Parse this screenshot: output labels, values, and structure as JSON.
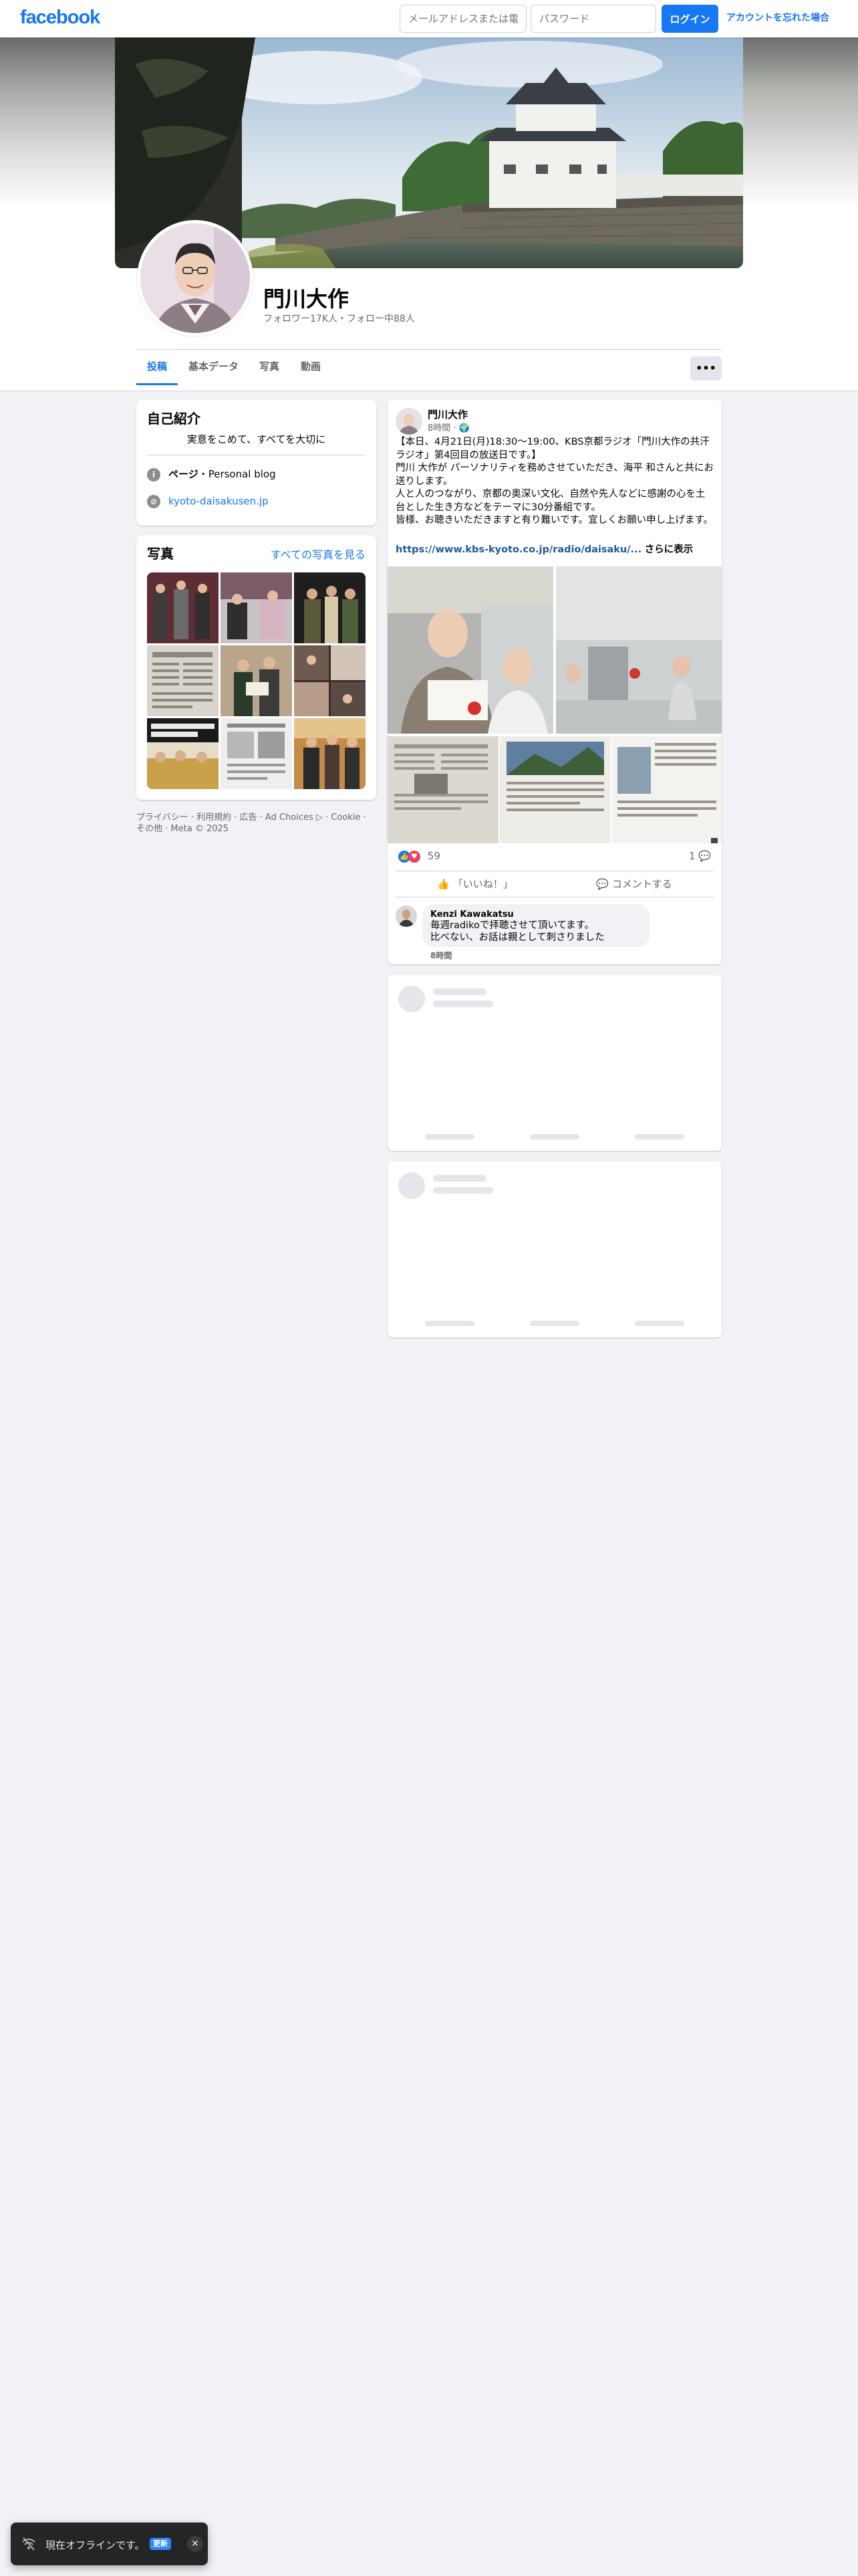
{
  "topbar": {
    "logo": "facebook",
    "email_placeholder": "メールアドレスまたは電話番号",
    "password_placeholder": "パスワード",
    "login_label": "ログイン",
    "forgot_label": "アカウントを忘れた場合"
  },
  "profile": {
    "name": "門川大作",
    "stats": "フォロワー17K人・フォロー中88人"
  },
  "tabs": [
    {
      "label": "投稿"
    },
    {
      "label": "基本データ"
    },
    {
      "label": "写真"
    },
    {
      "label": "動画"
    }
  ],
  "more_label": "•••",
  "intro": {
    "title": "自己紹介",
    "bio": "実意をこめて、すべてを大切に",
    "page_bold": "ページ",
    "page_text": "・Personal blog",
    "website": "kyoto-daisakusen.jp"
  },
  "photos": {
    "title": "写真",
    "see_all": "すべての写真を見る"
  },
  "footer": {
    "line1": "プライバシー · 利用規約 · 広告 · Ad Choices ▷ · Cookie ·",
    "line2": "その他 · Meta © 2025"
  },
  "post": {
    "author": "門川大作",
    "time": "8時間 · 🌍",
    "lines": [
      "【本日、4月21日(月)18:30〜19:00、KBS京都ラジオ「門川大作の共汗ラジオ」第4回目の放送日です。】",
      "門川 大作が パーソナリティを務めさせていただき、海平 和さんと共にお送りします。",
      "人と人のつながり、京都の奥深い文化、自然や先人などに感謝の心を土台とした生き方などをテーマに30分番組です。",
      "皆様、お聴きいただきますと有り難いです。宜しくお願い申し上げます。"
    ],
    "url": "https://www.kbs-kyoto.co.jp/radio/daisaku/...",
    "see_more": "さらに表示",
    "reaction_count": "59",
    "comment_count": "1",
    "like_label": "「いいね！」",
    "comment_label": "コメントする",
    "comment": {
      "name": "Kenzi Kawakatsu",
      "line1": "毎週radikoで拝聴させて頂いてます。",
      "line2": "比べない、お話は親として刺さりました",
      "time": "8時間"
    }
  },
  "toast": {
    "message": "現在オフラインです。",
    "badge": "更新",
    "close": "✕"
  }
}
